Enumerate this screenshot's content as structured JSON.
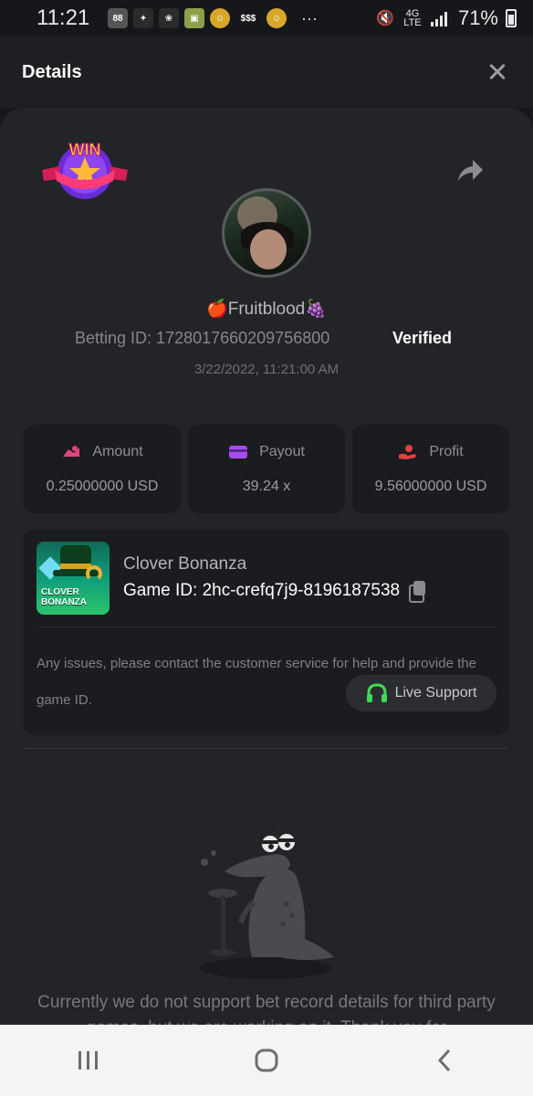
{
  "status_bar": {
    "time": "11:21",
    "battery": "71%",
    "network": "4G LTE",
    "more": "···"
  },
  "header": {
    "title": "Details",
    "close_icon": "close-icon"
  },
  "bet": {
    "win_badge_text": "WIN",
    "username": "🍎Fruitblood🍇",
    "betting_id": "Betting ID: 1728017660209756800",
    "verified": "Verified",
    "time": "3/22/2022, 11:21:00 AM"
  },
  "stats": [
    {
      "label": "Amount",
      "value": "0.25000000 USD",
      "icon": "amount-icon",
      "color": "#e0457b"
    },
    {
      "label": "Payout",
      "value": "39.24 x",
      "icon": "payout-icon",
      "color": "#a64df0"
    },
    {
      "label": "Profit",
      "value": "9.56000000 USD",
      "icon": "profit-icon",
      "color": "#e64040"
    }
  ],
  "game": {
    "thumb_text": "CLOVER BONANZA",
    "name": "Clover Bonanza",
    "id": "Game ID: 2hc-crefq7j9-8196187538",
    "support_text": "Any issues, please contact the customer service for help and provide the game ID.",
    "live_support": "Live Support"
  },
  "notice": "Currently we do not support bet record details for third party games, but we are working on it. Thank you for",
  "navbar": {
    "recent": "recent-apps-icon",
    "home": "home-icon",
    "back": "back-icon"
  },
  "colors": {
    "background": "#17181b",
    "panel": "#232427",
    "card": "#1b1c1f",
    "support_green": "#3ddc54"
  }
}
